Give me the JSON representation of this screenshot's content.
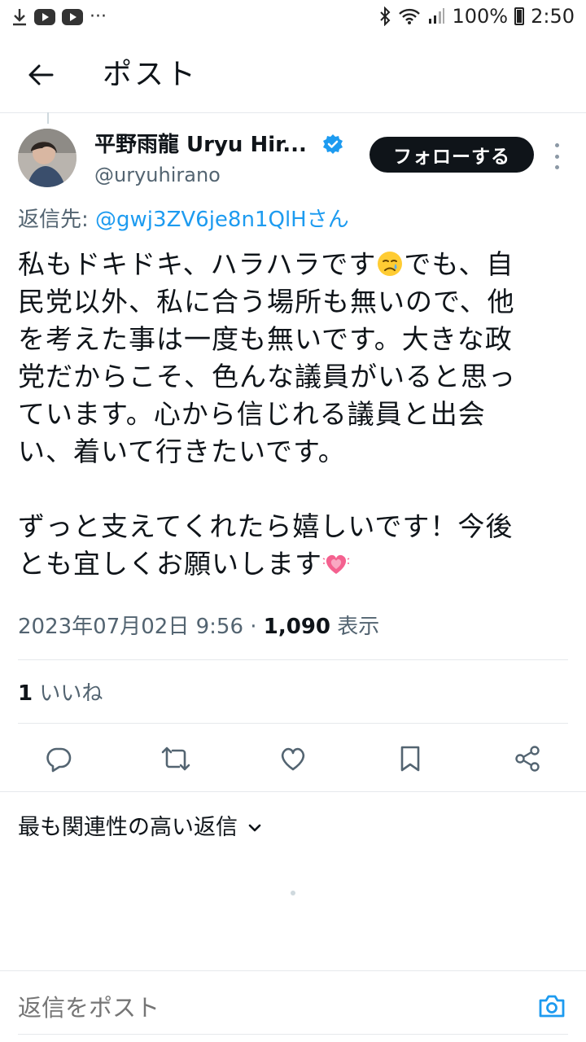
{
  "status_bar": {
    "more": "···",
    "battery": "100%",
    "time": "2:50"
  },
  "header": {
    "title": "ポスト"
  },
  "post": {
    "display_name": "平野雨龍 Uryu Hir...",
    "handle": "@uryuhirano",
    "follow_label": "フォローする",
    "reply_prefix": "返信先: ",
    "reply_mention": "@gwj3ZV6je8n1QlHさん",
    "text_part1": "私もドキドキ、ハラハラです",
    "text_part2": "でも、自\n民党以外、私に合う場所も無いので、他\nを考えた事は一度も無いです。大きな政\n党だからこそ、色んな議員がいると思っ\nています。心から信じれる議員と出会\nい、着いて行きたいです。\n\nずっと支えてくれたら嬉しいです！今後\nとも宜しくお願いします",
    "emoji_1": "crying-face-emoji",
    "emoji_2": "growing-heart-emoji",
    "timestamp": "2023年07月02日 9:56 · ",
    "views_count": "1,090",
    "views_label": " 表示",
    "likes_count": "1",
    "likes_label": " いいね"
  },
  "actions": [
    "reply-icon",
    "repost-icon",
    "like-icon",
    "bookmark-icon",
    "share-icon"
  ],
  "replies": {
    "sort_label": "最も関連性の高い返信"
  },
  "composer": {
    "placeholder": "返信をポスト"
  },
  "colors": {
    "accent": "#1d9bf0",
    "text": "#0f1419",
    "secondary": "#536471",
    "heart": "#f91880"
  }
}
